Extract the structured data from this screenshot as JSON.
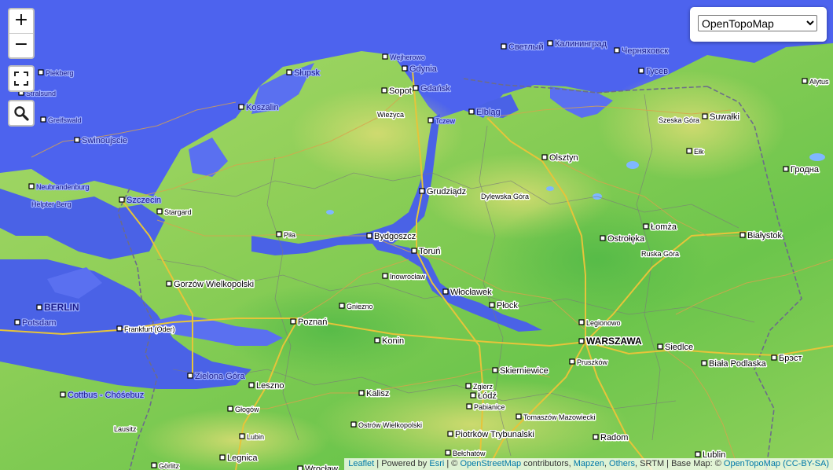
{
  "map": {
    "colors": {
      "sea": "#4d63ee",
      "flood": "#4a62e6",
      "land_low": "#5fc24a",
      "land_mid": "#9fd35a",
      "land_high": "#c8d86a",
      "border": "#777777",
      "road_major": "#e6c43a",
      "road_minor": "#d9a34c"
    },
    "cities": [
      {
        "name": "Piekberg",
        "size": "s",
        "sea": true,
        "dot": true
      },
      {
        "name": "Stralsund",
        "size": "s",
        "sea": true,
        "dot": true
      },
      {
        "name": "Greifswald",
        "size": "s",
        "sea": true,
        "dot": true
      },
      {
        "name": "Swinoujscie",
        "size": "m",
        "sea": true,
        "dot": true
      },
      {
        "name": "Neubrandenburg",
        "size": "s",
        "sea": true,
        "dot": true
      },
      {
        "name": "Helpter Berg",
        "size": "s",
        "sea": true,
        "dot": false
      },
      {
        "name": "Szczecin",
        "size": "m",
        "sea": true,
        "dot": true
      },
      {
        "name": "Stargard",
        "size": "s",
        "sea": false,
        "dot": true
      },
      {
        "name": "Koszalin",
        "size": "m",
        "sea": true,
        "dot": true
      },
      {
        "name": "Słupsk",
        "size": "m",
        "sea": true,
        "dot": true
      },
      {
        "name": "Wejherowo",
        "size": "s",
        "sea": true,
        "dot": true
      },
      {
        "name": "Gdynia",
        "size": "m",
        "sea": true,
        "dot": true
      },
      {
        "name": "Sopot",
        "size": "m",
        "sea": false,
        "dot": true
      },
      {
        "name": "Gdańsk",
        "size": "m",
        "sea": true,
        "dot": true
      },
      {
        "name": "Wieżyca",
        "size": "s",
        "sea": false,
        "dot": false
      },
      {
        "name": "Tczew",
        "size": "s",
        "sea": true,
        "dot": true
      },
      {
        "name": "Elbląg",
        "size": "m",
        "sea": true,
        "dot": true
      },
      {
        "name": "Светлый",
        "size": "m",
        "sea": true,
        "dot": true
      },
      {
        "name": "Калининград",
        "size": "m",
        "sea": true,
        "dot": true
      },
      {
        "name": "Черняховск",
        "size": "m",
        "sea": true,
        "dot": true
      },
      {
        "name": "Гусев",
        "size": "m",
        "sea": true,
        "dot": true
      },
      {
        "name": "Alytus",
        "size": "s",
        "sea": false,
        "dot": true
      },
      {
        "name": "Szeska Góra",
        "size": "s",
        "sea": false,
        "dot": false
      },
      {
        "name": "Suwałki",
        "size": "m",
        "sea": false,
        "dot": true
      },
      {
        "name": "Olsztyn",
        "size": "m",
        "sea": false,
        "dot": true
      },
      {
        "name": "Ełk",
        "size": "s",
        "sea": false,
        "dot": true
      },
      {
        "name": "Гродна",
        "size": "m",
        "sea": false,
        "dot": true
      },
      {
        "name": "Grudziądz",
        "size": "m",
        "sea": false,
        "dot": true
      },
      {
        "name": "Dylewska Góra",
        "size": "s",
        "sea": false,
        "dot": false
      },
      {
        "name": "Piła",
        "size": "s",
        "sea": false,
        "dot": true
      },
      {
        "name": "Bydgoszcz",
        "size": "m",
        "sea": false,
        "dot": true
      },
      {
        "name": "Toruń",
        "size": "m",
        "sea": false,
        "dot": true
      },
      {
        "name": "Ostrołęka",
        "size": "m",
        "sea": false,
        "dot": true
      },
      {
        "name": "Łomża",
        "size": "m",
        "sea": false,
        "dot": true
      },
      {
        "name": "Ruska Góra",
        "size": "s",
        "sea": false,
        "dot": false
      },
      {
        "name": "Białystok",
        "size": "m",
        "sea": false,
        "dot": true
      },
      {
        "name": "Gorzów Wielkopolski",
        "size": "m",
        "sea": false,
        "dot": true
      },
      {
        "name": "Inowrocław",
        "size": "s",
        "sea": false,
        "dot": true
      },
      {
        "name": "Włocławek",
        "size": "m",
        "sea": false,
        "dot": true
      },
      {
        "name": "Płock",
        "size": "m",
        "sea": false,
        "dot": true
      },
      {
        "name": "BERLIN",
        "size": "l",
        "sea": true,
        "dot": true
      },
      {
        "name": "Potsdam",
        "size": "m",
        "sea": true,
        "dot": true
      },
      {
        "name": "Gniezno",
        "size": "s",
        "sea": false,
        "dot": true
      },
      {
        "name": "Poznań",
        "size": "m",
        "sea": false,
        "dot": true
      },
      {
        "name": "Legionowo",
        "size": "s",
        "sea": false,
        "dot": true
      },
      {
        "name": "WARSZAWA",
        "size": "l",
        "sea": false,
        "dot": true
      },
      {
        "name": "Frankfurt (Oder)",
        "size": "s",
        "sea": false,
        "dot": true
      },
      {
        "name": "Konin",
        "size": "m",
        "sea": false,
        "dot": true
      },
      {
        "name": "Siedlce",
        "size": "m",
        "sea": false,
        "dot": true
      },
      {
        "name": "Pruszków",
        "size": "s",
        "sea": false,
        "dot": true
      },
      {
        "name": "Biała Podlaska",
        "size": "m",
        "sea": false,
        "dot": true
      },
      {
        "name": "Брэст",
        "size": "m",
        "sea": false,
        "dot": true
      },
      {
        "name": "Zielona Góra",
        "size": "m",
        "sea": true,
        "dot": true
      },
      {
        "name": "Skierniewice",
        "size": "m",
        "sea": false,
        "dot": true
      },
      {
        "name": "Leszno",
        "size": "m",
        "sea": false,
        "dot": true
      },
      {
        "name": "Cottbus - Chóśebuz",
        "size": "m",
        "sea": true,
        "dot": true
      },
      {
        "name": "Kalisz",
        "size": "m",
        "sea": false,
        "dot": true
      },
      {
        "name": "Zgierz",
        "size": "s",
        "sea": false,
        "dot": true
      },
      {
        "name": "Łódź",
        "size": "m",
        "sea": false,
        "dot": true
      },
      {
        "name": "Pabianice",
        "size": "s",
        "sea": false,
        "dot": true
      },
      {
        "name": "Głogów",
        "size": "s",
        "sea": false,
        "dot": true
      },
      {
        "name": "Tomaszów Mazowiecki",
        "size": "s",
        "sea": false,
        "dot": true
      },
      {
        "name": "Ostrów Wielkopolski",
        "size": "s",
        "sea": false,
        "dot": true
      },
      {
        "name": "Lubin",
        "size": "s",
        "sea": false,
        "dot": true
      },
      {
        "name": "Piotrków Trybunalski",
        "size": "m",
        "sea": false,
        "dot": true
      },
      {
        "name": "Radom",
        "size": "m",
        "sea": false,
        "dot": true
      },
      {
        "name": "Legnica",
        "size": "m",
        "sea": false,
        "dot": true
      },
      {
        "name": "Bełchatów",
        "size": "s",
        "sea": false,
        "dot": true
      },
      {
        "name": "Lublin",
        "size": "m",
        "sea": false,
        "dot": true
      },
      {
        "name": "Görlitz",
        "size": "s",
        "sea": false,
        "dot": true
      },
      {
        "name": "Wrocław",
        "size": "m",
        "sea": false,
        "dot": true
      },
      {
        "name": "Lausitz",
        "size": "s",
        "sea": false,
        "dot": false
      }
    ]
  },
  "controls": {
    "zoom_in": "+",
    "zoom_out": "−",
    "fullscreen_icon": "fullscreen-icon",
    "search_icon": "search-icon"
  },
  "layer_select": {
    "selected": "OpenTopoMap"
  },
  "attribution": {
    "leaflet": "Leaflet",
    "sep1": " | Powered by ",
    "esri": "Esri",
    "sep2": " | © ",
    "osm": "OpenStreetMap",
    "contributors": " contributors, ",
    "mapzen": "Mapzen",
    "comma": ", ",
    "others": "Others",
    "srtm": ", SRTM | Base Map: © ",
    "opentopomap": "OpenTopoMap",
    "license": " (CC-BY-SA)"
  }
}
